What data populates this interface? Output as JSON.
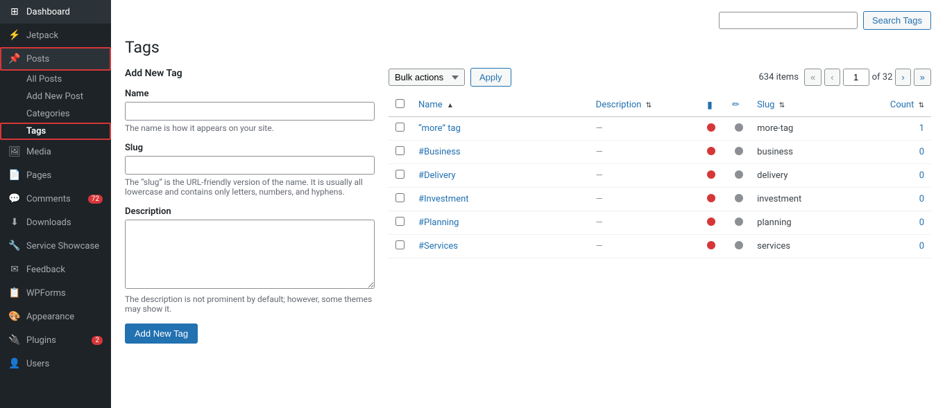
{
  "sidebar": {
    "items": [
      {
        "id": "dashboard",
        "label": "Dashboard",
        "icon": "⊞",
        "active": false
      },
      {
        "id": "jetpack",
        "label": "Jetpack",
        "icon": "⚡",
        "active": false
      },
      {
        "id": "posts",
        "label": "Posts",
        "icon": "📌",
        "active": true,
        "highlighted": true
      },
      {
        "id": "all-posts",
        "label": "All Posts",
        "sub": true,
        "active": false
      },
      {
        "id": "add-new-post",
        "label": "Add New Post",
        "sub": true,
        "active": false
      },
      {
        "id": "categories",
        "label": "Categories",
        "sub": true,
        "active": false
      },
      {
        "id": "tags",
        "label": "Tags",
        "sub": true,
        "active": true,
        "highlighted": true
      },
      {
        "id": "media",
        "label": "Media",
        "icon": "🖼",
        "active": false
      },
      {
        "id": "pages",
        "label": "Pages",
        "icon": "📄",
        "active": false
      },
      {
        "id": "comments",
        "label": "Comments",
        "icon": "💬",
        "active": false,
        "badge": "72"
      },
      {
        "id": "downloads",
        "label": "Downloads",
        "icon": "⬇",
        "active": false
      },
      {
        "id": "service-showcase",
        "label": "Service Showcase",
        "icon": "🔧",
        "active": false
      },
      {
        "id": "feedback",
        "label": "Feedback",
        "icon": "✉",
        "active": false
      },
      {
        "id": "wpforms",
        "label": "WPForms",
        "icon": "📋",
        "active": false
      },
      {
        "id": "appearance",
        "label": "Appearance",
        "icon": "🎨",
        "active": false
      },
      {
        "id": "plugins",
        "label": "Plugins",
        "icon": "🔌",
        "active": false,
        "badge": "2"
      },
      {
        "id": "users",
        "label": "Users",
        "icon": "👤",
        "active": false
      }
    ]
  },
  "page": {
    "title": "Tags",
    "search_placeholder": "",
    "search_btn_label": "Search Tags"
  },
  "add_tag_form": {
    "heading": "Add New Tag",
    "name_label": "Name",
    "name_placeholder": "",
    "name_help": "The name is how it appears on your site.",
    "slug_label": "Slug",
    "slug_placeholder": "",
    "slug_help": "The “slug” is the URL-friendly version of the name. It is usually all lowercase and contains only letters, numbers, and hyphens.",
    "description_label": "Description",
    "description_placeholder": "",
    "description_help": "The description is not prominent by default; however, some themes may show it.",
    "submit_label": "Add New Tag"
  },
  "bulk_bar": {
    "bulk_actions_label": "Bulk actions",
    "apply_label": "Apply",
    "items_count": "634 items",
    "page_current": "1",
    "page_total": "32",
    "pag_first": "«",
    "pag_prev": "‹",
    "pag_next": "›",
    "pag_last": "»"
  },
  "table": {
    "col_name": "Name",
    "col_description": "Description",
    "col_slug": "Slug",
    "col_count": "Count",
    "rows": [
      {
        "name": "“more” tag",
        "description": "—",
        "slug": "more-tag",
        "count": "1"
      },
      {
        "name": "#Business",
        "description": "—",
        "slug": "business",
        "count": "0"
      },
      {
        "name": "#Delivery",
        "description": "—",
        "slug": "delivery",
        "count": "0"
      },
      {
        "name": "#Investment",
        "description": "—",
        "slug": "investment",
        "count": "0"
      },
      {
        "name": "#Planning",
        "description": "—",
        "slug": "planning",
        "count": "0"
      },
      {
        "name": "#Services",
        "description": "—",
        "slug": "services",
        "count": "0"
      }
    ]
  }
}
